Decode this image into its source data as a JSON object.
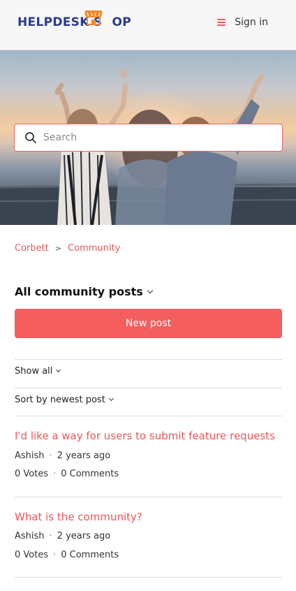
{
  "header": {
    "logo_text_part1": "HELPDESK S",
    "logo_text_part2": "OP",
    "menu_icon": "hamburger-menu-icon",
    "signin_label": "Sign in"
  },
  "search": {
    "placeholder": "Search",
    "icon": "search-icon"
  },
  "breadcrumb": {
    "items": [
      "Corbett",
      "Community"
    ],
    "separator": ">"
  },
  "main": {
    "title": "All community posts",
    "new_post_label": "New post",
    "filter_show": "Show all",
    "filter_sort": "Sort by newest post"
  },
  "posts": [
    {
      "title": "I'd like a way for users to submit feature requests",
      "author": "Ashish",
      "time": "2 years ago",
      "votes": "0 Votes",
      "comments": "0 Comments"
    },
    {
      "title": "What is the community?",
      "author": "Ashish",
      "time": "2 years ago",
      "votes": "0 Votes",
      "comments": "0 Comments"
    }
  ],
  "colors": {
    "accent": "#f45e5e",
    "link": "#e8575a",
    "brand_blue": "#2b3a8f",
    "brand_orange": "#f28a2e"
  }
}
